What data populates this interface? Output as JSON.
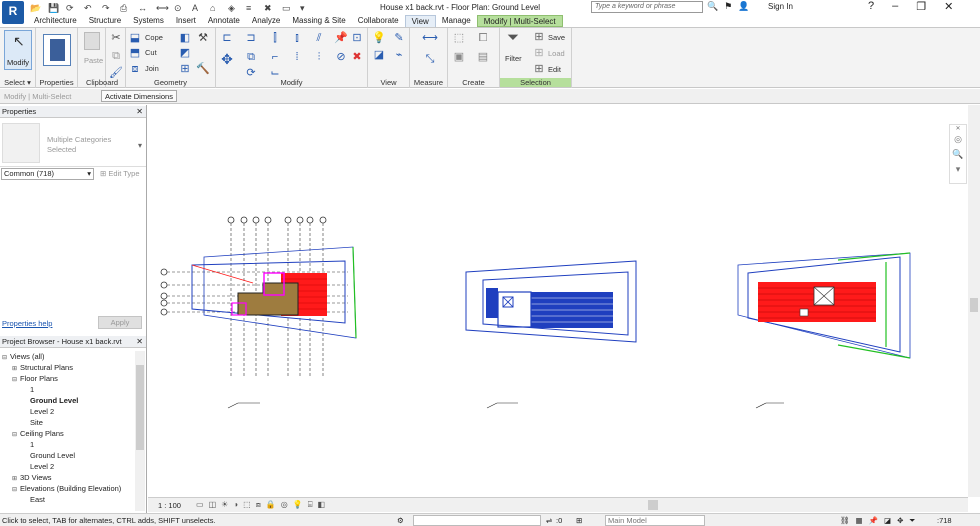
{
  "titlebar": {
    "app_logo": "R",
    "document_title": "House x1 back.rvt - Floor Plan: Ground Level",
    "search_placeholder": "Type a keyword or phrase",
    "sign_in": "Sign In"
  },
  "tabs": [
    "Architecture",
    "Structure",
    "Systems",
    "Insert",
    "Annotate",
    "Analyze",
    "Massing & Site",
    "Collaborate",
    "View",
    "Manage",
    "Modify | Multi-Select"
  ],
  "active_tab": "View",
  "ribbon": {
    "modify_label": "Modify",
    "groups": [
      "Select",
      "Properties",
      "Clipboard",
      "Geometry",
      "Modify",
      "View",
      "Measure",
      "Create",
      "Selection"
    ],
    "select_dropdown": "Select",
    "paste": "Paste",
    "cope": "Cope",
    "cut": "Cut",
    "join": "Join",
    "filter": "Filter",
    "save": "Save",
    "load": "Load",
    "edit": "Edit"
  },
  "options_bar": {
    "context": "Modify | Multi-Select",
    "activate_dimensions": "Activate Dimensions"
  },
  "properties": {
    "header": "Properties",
    "type_line1": "Multiple Categories",
    "type_line2": "Selected",
    "filter_value": "Common (718)",
    "edit_type": "Edit Type",
    "help_link": "Properties help",
    "apply": "Apply"
  },
  "project_browser": {
    "header": "Project Browser - House x1 back.rvt",
    "nodes": [
      {
        "label": "Views (all)",
        "level": 0,
        "toggle": "⊟",
        "bold": false
      },
      {
        "label": "Structural Plans",
        "level": 1,
        "toggle": "⊞",
        "bold": false
      },
      {
        "label": "Floor Plans",
        "level": 1,
        "toggle": "⊟",
        "bold": false
      },
      {
        "label": "1",
        "level": 2,
        "toggle": "",
        "bold": false
      },
      {
        "label": "Ground Level",
        "level": 2,
        "toggle": "",
        "bold": true
      },
      {
        "label": "Level 2",
        "level": 2,
        "toggle": "",
        "bold": false
      },
      {
        "label": "Site",
        "level": 2,
        "toggle": "",
        "bold": false
      },
      {
        "label": "Ceiling Plans",
        "level": 1,
        "toggle": "⊟",
        "bold": false
      },
      {
        "label": "1",
        "level": 2,
        "toggle": "",
        "bold": false
      },
      {
        "label": "Ground Level",
        "level": 2,
        "toggle": "",
        "bold": false
      },
      {
        "label": "Level 2",
        "level": 2,
        "toggle": "",
        "bold": false
      },
      {
        "label": "3D Views",
        "level": 1,
        "toggle": "⊞",
        "bold": false
      },
      {
        "label": "Elevations (Building Elevation)",
        "level": 1,
        "toggle": "⊟",
        "bold": false
      },
      {
        "label": "East",
        "level": 2,
        "toggle": "",
        "bold": false
      }
    ]
  },
  "view_control": {
    "scale": "1 : 100"
  },
  "status_bar": {
    "message": "Click to select, TAB for alternates, CTRL adds, SHIFT unselects.",
    "zero": ":0",
    "model": "Main Model",
    "count": ":718"
  },
  "colors": {
    "blue_lines": "#1f3fbf",
    "red_fill": "#ff1a1a",
    "green_lines": "#22c022",
    "magenta": "#ff00ff",
    "context_tab": "#b6df9c"
  }
}
